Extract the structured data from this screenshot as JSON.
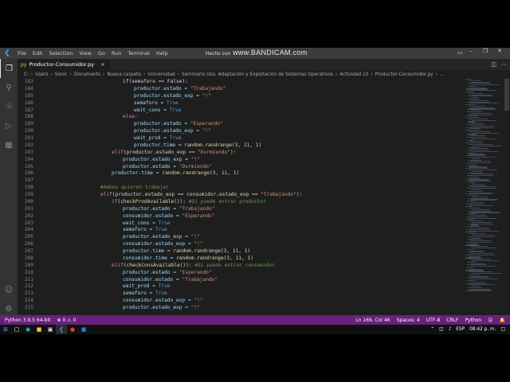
{
  "title_bar": {
    "menu": [
      "File",
      "Edit",
      "Selection",
      "View",
      "Go",
      "Run",
      "Terminal",
      "Help"
    ],
    "watermark_main": "www.BANDICAM.com",
    "watermark_prefix": "Hecho con"
  },
  "tab": {
    "file_icon": "py",
    "label": "Productor-Consumidor.py",
    "close": "×"
  },
  "breadcrumb": [
    "C:",
    "Users",
    "Sonic",
    "Documents",
    "Nueva carpeta",
    "Universidad",
    "Seminario Uso, Adaptación y Explotación de Sistemas Operativos",
    "Actividad 10",
    "Productor-Consumidor.py",
    "..."
  ],
  "code_lines": [
    {
      "n": "183",
      "indent": 4,
      "tokens": [
        [
          "if(semaforo == False):",
          "#d4d4d4"
        ]
      ]
    },
    {
      "n": "184",
      "indent": 5,
      "tokens": [
        [
          "productor.estado = ",
          "#9cdcfe"
        ],
        [
          "\"Trabajando\"",
          "#ce9178"
        ]
      ]
    },
    {
      "n": "185",
      "indent": 5,
      "tokens": [
        [
          "productor.estado_exp = ",
          "#9cdcfe"
        ],
        [
          "\"!\"",
          "#ce9178"
        ]
      ]
    },
    {
      "n": "186",
      "indent": 5,
      "tokens": [
        [
          "semaforo = ",
          "#9cdcfe"
        ],
        [
          "True",
          "#569cd6"
        ]
      ]
    },
    {
      "n": "187",
      "indent": 5,
      "tokens": [
        [
          "wait_cons = ",
          "#9cdcfe"
        ],
        [
          "True",
          "#569cd6"
        ]
      ]
    },
    {
      "n": "188",
      "indent": 4,
      "tokens": [
        [
          "else:",
          "#c586c0"
        ]
      ]
    },
    {
      "n": "189",
      "indent": 5,
      "tokens": [
        [
          "productor.estado = ",
          "#9cdcfe"
        ],
        [
          "\"Esperando\"",
          "#ce9178"
        ]
      ]
    },
    {
      "n": "190",
      "indent": 5,
      "tokens": [
        [
          "productor.estado_exp = ",
          "#9cdcfe"
        ],
        [
          "\"!\"",
          "#ce9178"
        ]
      ]
    },
    {
      "n": "191",
      "indent": 5,
      "tokens": [
        [
          "wait_prod = ",
          "#9cdcfe"
        ],
        [
          "True",
          "#569cd6"
        ]
      ]
    },
    {
      "n": "192",
      "indent": 5,
      "tokens": [
        [
          "productor.time = ",
          "#9cdcfe"
        ],
        [
          "random.randrange",
          "#dcdcaa"
        ],
        [
          "(3, 11, 1)",
          "#d4d4d4"
        ]
      ]
    },
    {
      "n": "193",
      "indent": 3,
      "tokens": [
        [
          "elif",
          "#c586c0"
        ],
        [
          "(productor.estado_exp == ",
          "#d4d4d4"
        ],
        [
          "\"Durmiendo\"",
          "#ce9178"
        ],
        [
          "):",
          "#d4d4d4"
        ]
      ]
    },
    {
      "n": "194",
      "indent": 4,
      "tokens": [
        [
          "productor.estado_exp = ",
          "#9cdcfe"
        ],
        [
          "\"!\"",
          "#ce9178"
        ]
      ]
    },
    {
      "n": "195",
      "indent": 4,
      "tokens": [
        [
          "productor.estado = ",
          "#9cdcfe"
        ],
        [
          "\"Durmiendo\"",
          "#ce9178"
        ]
      ]
    },
    {
      "n": "196",
      "indent": 3,
      "tokens": [
        [
          "productor.time = ",
          "#9cdcfe"
        ],
        [
          "random.randrange",
          "#dcdcaa"
        ],
        [
          "(3, 11, 1)",
          "#d4d4d4"
        ]
      ]
    },
    {
      "n": "197",
      "indent": 0,
      "tokens": []
    },
    {
      "n": "198",
      "indent": 2,
      "tokens": [
        [
          "#Ambos quieren trabajar",
          "#6a9955"
        ]
      ]
    },
    {
      "n": "199",
      "indent": 2,
      "tokens": [
        [
          "elif",
          "#c586c0"
        ],
        [
          "(productor.estado_exp == consumidor.estado_exp == ",
          "#d4d4d4"
        ],
        [
          "\"Trabajando\"",
          "#ce9178"
        ],
        [
          "):",
          "#d4d4d4"
        ]
      ]
    },
    {
      "n": "200",
      "indent": 3,
      "tokens": [
        [
          "if",
          "#c586c0"
        ],
        [
          "(",
          "#d4d4d4"
        ],
        [
          "checkProdAvailable",
          "#dcdcaa"
        ],
        [
          "()): ",
          "#d4d4d4"
        ],
        [
          "#Si puede entrar productor",
          "#6a9955"
        ]
      ]
    },
    {
      "n": "201",
      "indent": 4,
      "tokens": [
        [
          "productor.estado = ",
          "#9cdcfe"
        ],
        [
          "\"Trabajando\"",
          "#ce9178"
        ]
      ]
    },
    {
      "n": "202",
      "indent": 4,
      "tokens": [
        [
          "consumidor.estado = ",
          "#9cdcfe"
        ],
        [
          "\"Esperando\"",
          "#ce9178"
        ]
      ]
    },
    {
      "n": "203",
      "indent": 4,
      "tokens": [
        [
          "wait_cons = ",
          "#9cdcfe"
        ],
        [
          "True",
          "#569cd6"
        ]
      ]
    },
    {
      "n": "204",
      "indent": 4,
      "tokens": [
        [
          "semaforo = ",
          "#9cdcfe"
        ],
        [
          "True",
          "#569cd6"
        ]
      ]
    },
    {
      "n": "205",
      "indent": 4,
      "tokens": [
        [
          "productor.estado_exp = ",
          "#9cdcfe"
        ],
        [
          "\"!\"",
          "#ce9178"
        ]
      ]
    },
    {
      "n": "206",
      "indent": 4,
      "tokens": [
        [
          "consumidor.estado_exp = ",
          "#9cdcfe"
        ],
        [
          "\"!\"",
          "#ce9178"
        ]
      ]
    },
    {
      "n": "207",
      "indent": 4,
      "tokens": [
        [
          "productor.time = ",
          "#9cdcfe"
        ],
        [
          "random.randrange",
          "#dcdcaa"
        ],
        [
          "(3, 11, 1)",
          "#d4d4d4"
        ]
      ]
    },
    {
      "n": "208",
      "indent": 4,
      "tokens": [
        [
          "consumidor.time = ",
          "#9cdcfe"
        ],
        [
          "random.randrange",
          "#dcdcaa"
        ],
        [
          "(3, 11, 1)",
          "#d4d4d4"
        ]
      ]
    },
    {
      "n": "209",
      "indent": 3,
      "tokens": [
        [
          "elif",
          "#c586c0"
        ],
        [
          "(",
          "#d4d4d4"
        ],
        [
          "checkConsAvailable",
          "#dcdcaa"
        ],
        [
          "()): ",
          "#d4d4d4"
        ],
        [
          "#Si puede entrar consumidor",
          "#6a9955"
        ]
      ]
    },
    {
      "n": "210",
      "indent": 4,
      "tokens": [
        [
          "productor.estado = ",
          "#9cdcfe"
        ],
        [
          "\"Esperando\"",
          "#ce9178"
        ]
      ]
    },
    {
      "n": "211",
      "indent": 4,
      "tokens": [
        [
          "consumidor.estado = ",
          "#9cdcfe"
        ],
        [
          "\"Trabajando\"",
          "#ce9178"
        ]
      ]
    },
    {
      "n": "212",
      "indent": 4,
      "tokens": [
        [
          "wait_prod = ",
          "#9cdcfe"
        ],
        [
          "True",
          "#569cd6"
        ]
      ]
    },
    {
      "n": "213",
      "indent": 4,
      "tokens": [
        [
          "semaforo = ",
          "#9cdcfe"
        ],
        [
          "True",
          "#569cd6"
        ]
      ]
    },
    {
      "n": "214",
      "indent": 4,
      "tokens": [
        [
          "consumidor.estado_exp = ",
          "#9cdcfe"
        ],
        [
          "\"!\"",
          "#ce9178"
        ]
      ]
    },
    {
      "n": "215",
      "indent": 4,
      "tokens": [
        [
          "productor.estado_exp = ",
          "#9cdcfe"
        ],
        [
          "\"!\"",
          "#ce9178"
        ]
      ]
    }
  ],
  "status_bar": {
    "python_version": "Python 3.9.5 64-bit",
    "problems": "⊗ 0 ⚠ 0",
    "cursor": "Ln 169, Col 46",
    "spaces": "Spaces: 4",
    "encoding": "UTF-8",
    "eol": "CRLF",
    "language": "Python",
    "color": "#68217a"
  },
  "taskbar": {
    "language": "ESP",
    "time": "08:42 p. m."
  },
  "colors": {
    "editor_bg": "#1e1e1e",
    "titlebar_bg": "#3c3c3c",
    "activity_bg": "#333333",
    "taskbar_bg": "#101010"
  }
}
